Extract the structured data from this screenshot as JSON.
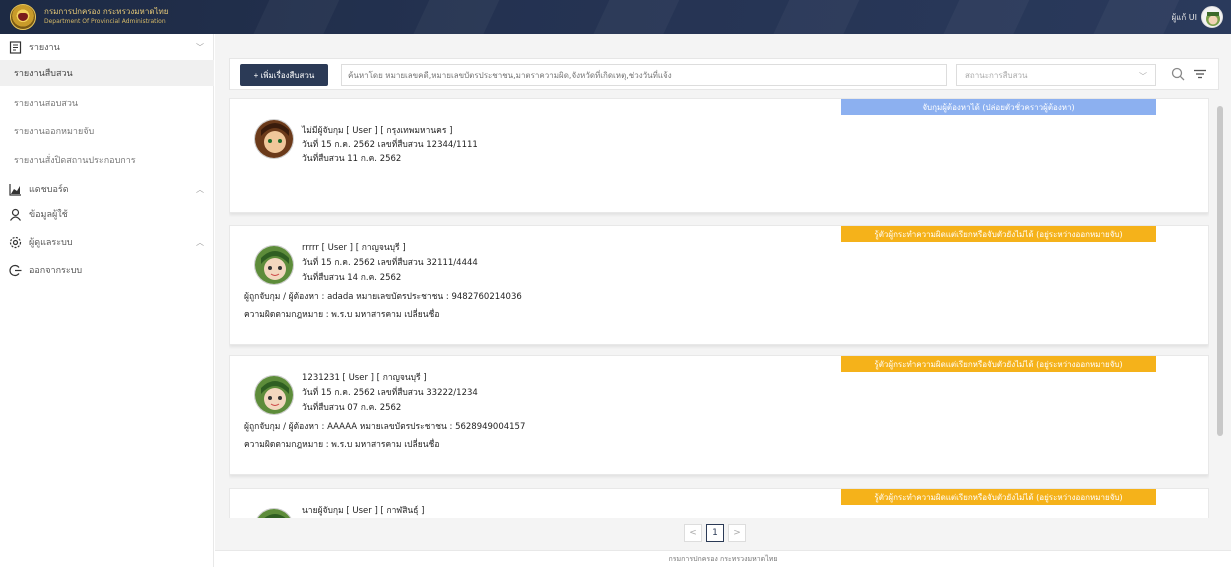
{
  "header": {
    "org_name_th": "กรมการปกครอง กระทรวงมหาดไทย",
    "org_name_en": "Department Of Provincial Administration",
    "user_label": "ผู้แก้ UI"
  },
  "sidebar": {
    "items": [
      {
        "label": "รายงาน",
        "icon": "report-icon"
      },
      {
        "label": "รายงานสืบสวน"
      },
      {
        "label": "รายงานสอบสวน"
      },
      {
        "label": "รายงานออกหมายจับ"
      },
      {
        "label": "รายงานสั่งปิดสถานประกอบการ"
      },
      {
        "label": "แดชบอร์ด",
        "icon": "chart-icon"
      },
      {
        "label": "ข้อมูลผู้ใช้",
        "icon": "user-icon"
      },
      {
        "label": "ผู้ดูแลระบบ",
        "icon": "gear-icon"
      },
      {
        "label": "ออกจากระบบ",
        "icon": "logout-icon"
      }
    ]
  },
  "toolbar": {
    "add_label": "+ เพิ่มเรื่องสืบสวน",
    "search_placeholder": "ค้นหาโดย หมายเลขคดี,หมายเลขบัตรประชาชน,มาตราความผิด,จังหวัดที่เกิดเหตุ,ช่วงวันที่แจ้ง",
    "status_placeholder": "สถานะการสืบสวน"
  },
  "cards": [
    {
      "badge": "จับกุมผู้ต้องหาได้ (ปล่อยตัวชั่วคราวผู้ต้องหา)",
      "badge_color": "#8cb0f0",
      "title": "ไม่มีผู้จับกุม [ User ] [ กรุงเทพมหานคร ]",
      "date_line": "วันที่ 15 ก.ค. 2562 เลขที่สืบสวน 12344/1111",
      "invest_date": "วันที่สืบสวน 11 ก.ค. 2562",
      "suspect": "",
      "offense": ""
    },
    {
      "badge": "รู้ตัวผู้กระทำความผิดแต่เรียกหรือจับตัวยังไม่ได้ (อยู่ระหว่างออกหมายจับ)",
      "badge_color": "#f5b21a",
      "title": "rrrrr [ User ] [ กาญจนบุรี ]",
      "date_line": "วันที่ 15 ก.ค. 2562 เลขที่สืบสวน 32111/4444",
      "invest_date": "วันที่สืบสวน 14 ก.ค. 2562",
      "suspect": "ผู้ถูกจับกุม / ผู้ต้องหา : adada หมายเลขบัตรประชาชน : 9482760214036",
      "offense": "ความผิดตามกฎหมาย : พ.ร.บ มหาสารคาม เปลี่ยนชื่อ"
    },
    {
      "badge": "รู้ตัวผู้กระทำความผิดแต่เรียกหรือจับตัวยังไม่ได้ (อยู่ระหว่างออกหมายจับ)",
      "badge_color": "#f5b21a",
      "title": "1231231 [ User ] [ กาญจนบุรี ]",
      "date_line": "วันที่ 15 ก.ค. 2562 เลขที่สืบสวน 33222/1234",
      "invest_date": "วันที่สืบสวน 07 ก.ค. 2562",
      "suspect": "ผู้ถูกจับกุม / ผู้ต้องหา : AAAAA หมายเลขบัตรประชาชน : 5628949004157",
      "offense": "ความผิดตามกฎหมาย : พ.ร.บ มหาสารคาม เปลี่ยนชื่อ"
    },
    {
      "badge": "รู้ตัวผู้กระทำความผิดแต่เรียกหรือจับตัวยังไม่ได้ (อยู่ระหว่างออกหมายจับ)",
      "badge_color": "#f5b21a",
      "title": "นายผู้จับกุม [ User ] [ กาฬสินธุ์ ]",
      "date_line": "",
      "invest_date": "",
      "suspect": "",
      "offense": ""
    }
  ],
  "pagination": {
    "prev": "<",
    "current": "1",
    "next": ">"
  },
  "footer": {
    "text": "กรมการปกครอง กระทรวงมหาดไทย"
  }
}
